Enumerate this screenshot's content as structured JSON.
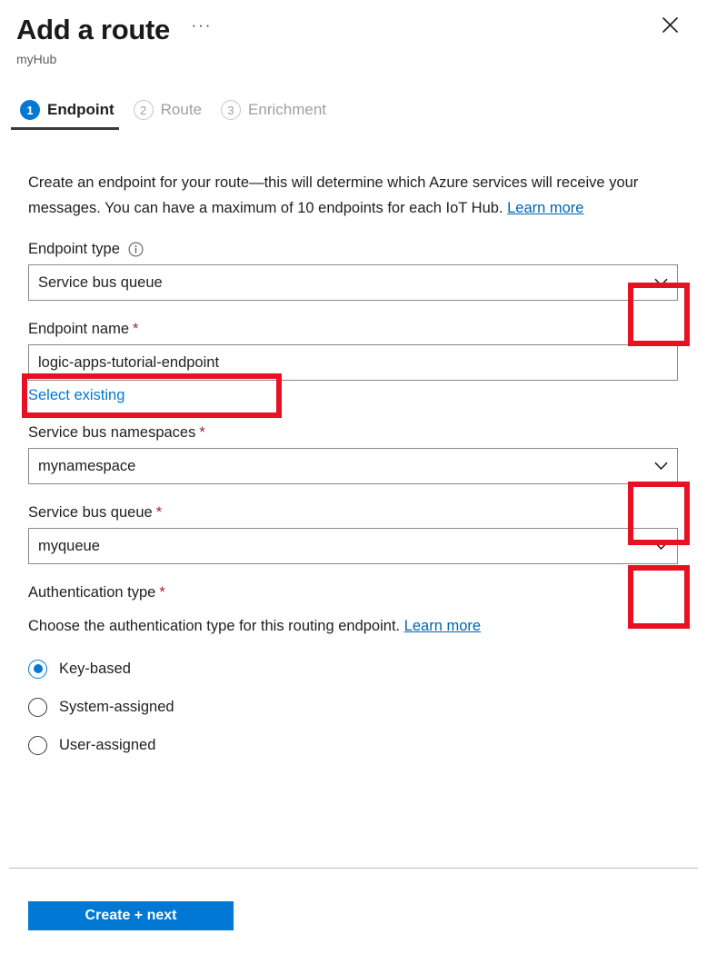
{
  "header": {
    "title": "Add a route",
    "subtitle": "myHub",
    "ellipsis_label": "···",
    "close_label": "Close"
  },
  "tabs": [
    {
      "num": "1",
      "label": "Endpoint",
      "state": "active"
    },
    {
      "num": "2",
      "label": "Route",
      "state": "inactive"
    },
    {
      "num": "3",
      "label": "Enrichment",
      "state": "inactive"
    }
  ],
  "intro": {
    "text": "Create an endpoint for your route—this will determine which Azure services will receive your messages. You can have a maximum of 10 endpoints for each IoT Hub. ",
    "link": "Learn more"
  },
  "fields": {
    "endpoint_type": {
      "label": "Endpoint type",
      "value": "Service bus queue",
      "info_icon": "info-icon"
    },
    "endpoint_name": {
      "label": "Endpoint name",
      "required_mark": "*",
      "value": "logic-apps-tutorial-endpoint",
      "placeholder": "",
      "select_existing_link": "Select existing"
    },
    "service_bus_namespaces": {
      "label": "Service bus namespaces",
      "required_mark": "*",
      "value": "mynamespace"
    },
    "service_bus_queue": {
      "label": "Service bus queue",
      "required_mark": "*",
      "value": "myqueue"
    },
    "authentication_type": {
      "label": "Authentication type",
      "required_mark": "*",
      "description": "Choose the authentication type for this routing endpoint. ",
      "link": "Learn more",
      "options": [
        {
          "label": "Key-based",
          "selected": true
        },
        {
          "label": "System-assigned",
          "selected": false
        },
        {
          "label": "User-assigned",
          "selected": false
        }
      ]
    }
  },
  "footer": {
    "primary_button": "Create + next"
  },
  "colors": {
    "accent": "#0078d4",
    "required": "#a4262c",
    "link": "#0065b3",
    "annotation": "#e81123",
    "muted": "#a19f9d"
  }
}
